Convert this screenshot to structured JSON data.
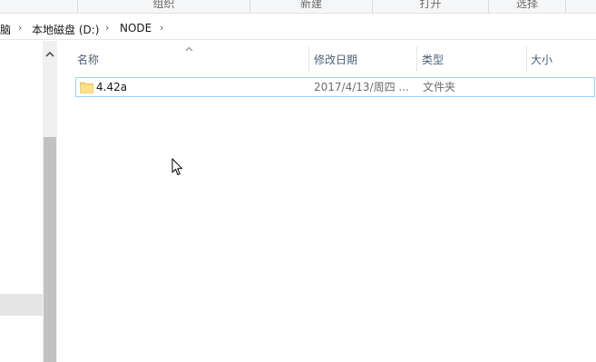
{
  "ribbon": {
    "groups": [
      "组织",
      "新建",
      "打开",
      "选择"
    ]
  },
  "address": {
    "crumbs": [
      "脑",
      "本地磁盘 (D:)",
      "NODE"
    ]
  },
  "columns": {
    "name": "名称",
    "modified": "修改日期",
    "type": "类型",
    "size": "大小"
  },
  "files": [
    {
      "name": "4.42a",
      "modified": "2017/4/13/周四 ...",
      "type": "文件夹",
      "size": ""
    }
  ],
  "colors": {
    "selection_border": "#99d1ff",
    "header_text": "#4c607a",
    "folder_yellow": "#f8d775"
  }
}
